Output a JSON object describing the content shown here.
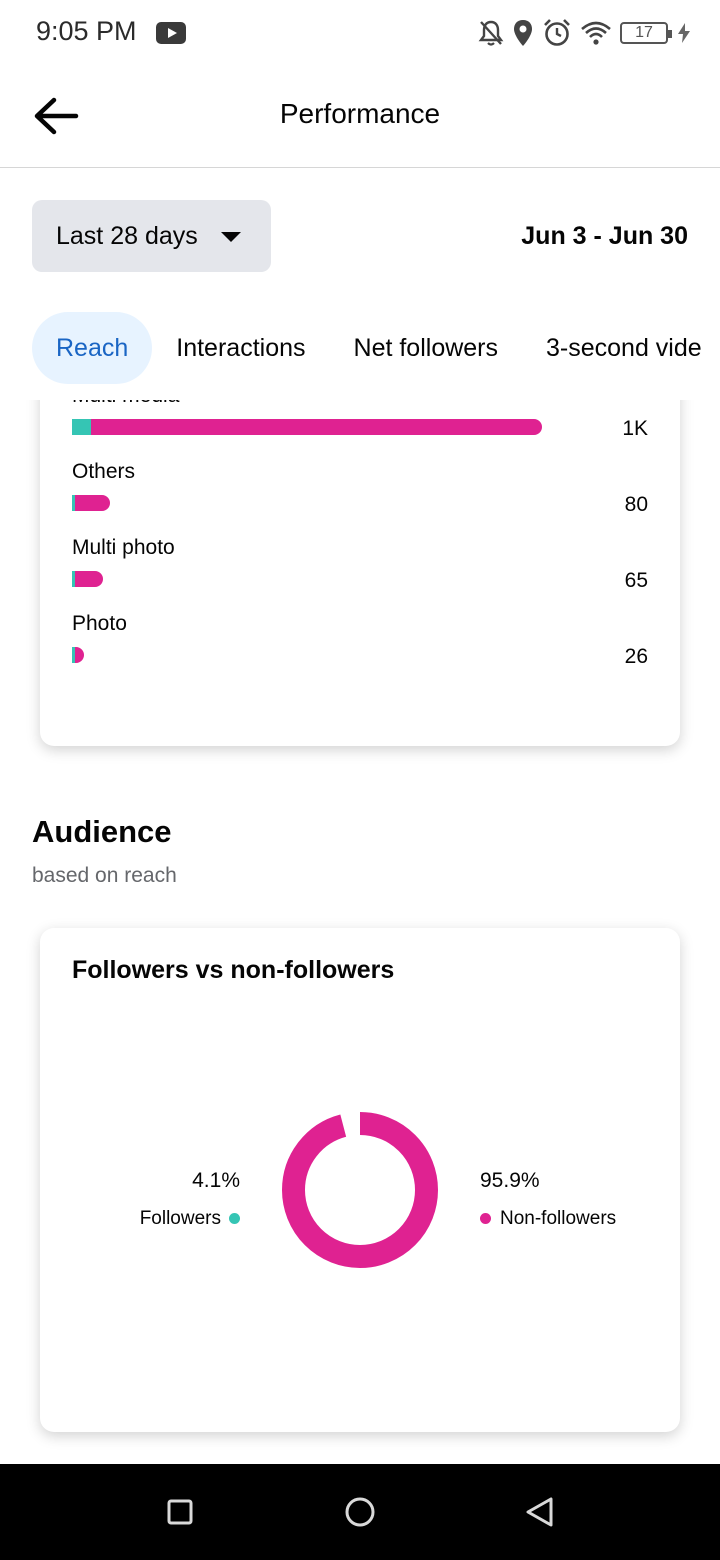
{
  "status_bar": {
    "time": "9:05 PM",
    "battery": "17",
    "icons": [
      "youtube-icon",
      "notifications-off-icon",
      "location-icon",
      "alarm-icon",
      "wifi-icon",
      "battery-icon",
      "charging-icon"
    ]
  },
  "header": {
    "title": "Performance",
    "back_icon": "arrow-left-icon"
  },
  "filters": {
    "range_label": "Last 28 days",
    "date_range": "Jun 3 - Jun 30"
  },
  "tabs": [
    {
      "label": "Reach",
      "active": true
    },
    {
      "label": "Interactions",
      "active": false
    },
    {
      "label": "Net followers",
      "active": false
    },
    {
      "label": "3-second vide",
      "active": false
    }
  ],
  "content_types": {
    "rows": [
      {
        "label": "Multi media",
        "value": "1K"
      },
      {
        "label": "Others",
        "value": "80"
      },
      {
        "label": "Multi photo",
        "value": "65"
      },
      {
        "label": "Photo",
        "value": "26"
      }
    ]
  },
  "audience": {
    "title": "Audience",
    "subtitle": "based on reach",
    "card_title": "Followers vs non-followers",
    "followers_pct": "4.1%",
    "followers_label": "Followers",
    "non_followers_pct": "95.9%",
    "non_followers_label": "Non-followers"
  },
  "colors": {
    "followers": "#35c5b4",
    "non_followers": "#df2291",
    "active_tab_bg": "#e7f3ff",
    "active_tab_text": "#1a65c4"
  },
  "chart_data": [
    {
      "type": "bar",
      "categories": [
        "Multi media",
        "Others",
        "Multi photo",
        "Photo"
      ],
      "series": [
        {
          "name": "Followers",
          "values": [
            42,
            4,
            3,
            1
          ]
        },
        {
          "name": "Non-followers",
          "values": [
            1000,
            76,
            62,
            25
          ]
        }
      ],
      "totals": [
        1000,
        80,
        65,
        26
      ]
    },
    {
      "type": "pie",
      "title": "Followers vs non-followers",
      "categories": [
        "Followers",
        "Non-followers"
      ],
      "values": [
        4.1,
        95.9
      ]
    }
  ],
  "nav": {
    "icons": [
      "recents-square-icon",
      "home-circle-icon",
      "back-triangle-icon"
    ]
  }
}
